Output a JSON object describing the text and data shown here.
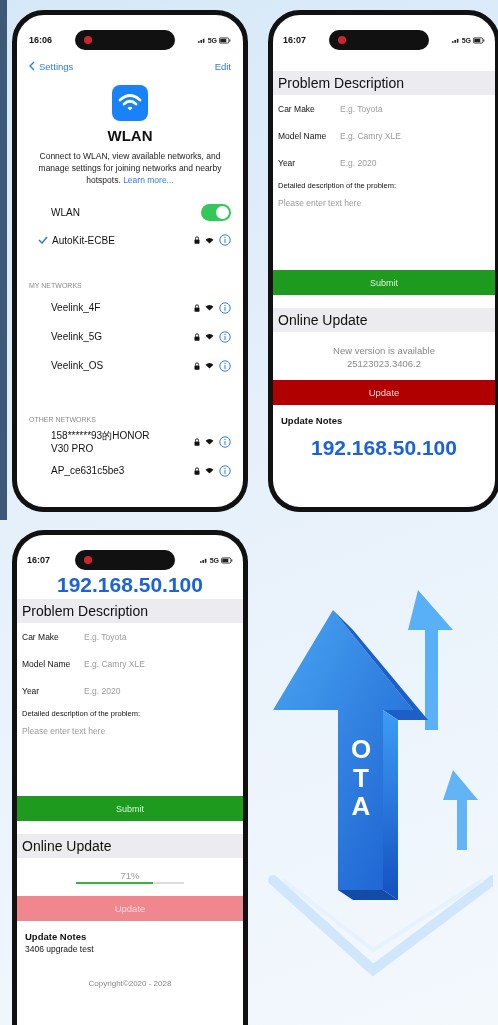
{
  "wlan_screen": {
    "status_bar": {
      "time": "16:06",
      "network": "5G"
    },
    "nav": {
      "back": "Settings",
      "action": "Edit"
    },
    "title": "WLAN",
    "description": "Connect to WLAN, view available networks, and manage settings for joining networks and nearby hotspots.",
    "learn_more": "Learn more...",
    "wlan_toggle": {
      "label": "WLAN",
      "on": true
    },
    "connected": {
      "name": "AutoKit-ECBE",
      "selected": true
    },
    "sections": [
      {
        "heading": "MY NETWORKS",
        "networks": [
          {
            "name": "Veelink_4F"
          },
          {
            "name": "Veelink_5G"
          },
          {
            "name": "Veelink_OS"
          }
        ]
      },
      {
        "heading": "OTHER NETWORKS",
        "networks": [
          {
            "name": "158******93的HONOR V30 PRO"
          },
          {
            "name": "AP_ce631c5be3"
          }
        ]
      }
    ]
  },
  "form_screens": [
    {
      "status_bar": {
        "time": "16:07",
        "network": "5G"
      },
      "footer_ip": "192.168.50.100",
      "problem": {
        "title": "Problem Description",
        "fields": [
          {
            "label": "Car Make",
            "placeholder": "E.g. Toyota"
          },
          {
            "label": "Model Name",
            "placeholder": "E.g. Camry XLE"
          },
          {
            "label": "Year",
            "placeholder": "E.g. 2020"
          }
        ],
        "detail_label": "Detailed description of the problem:",
        "detail_placeholder": "Please enter text here",
        "submit": "Submit"
      },
      "update": {
        "title": "Online Update",
        "kind": "available",
        "message": "New version is available",
        "version": "25123023.3406.2",
        "button": {
          "label": "Update",
          "disabled": false
        }
      },
      "notes": {
        "title": "Update Notes"
      }
    },
    {
      "status_bar": {
        "time": "16:07",
        "network": "5G"
      },
      "header_ip": "192.168.50.100",
      "problem": {
        "title": "Problem Description",
        "fields": [
          {
            "label": "Car Make",
            "placeholder": "E.g. Toyota"
          },
          {
            "label": "Model Name",
            "placeholder": "E.g. Camry XLE"
          },
          {
            "label": "Year",
            "placeholder": "E.g. 2020"
          }
        ],
        "detail_label": "Detailed description of the problem:",
        "detail_placeholder": "Please enter text here",
        "submit": "Submit"
      },
      "update": {
        "title": "Online Update",
        "kind": "progress",
        "percent": "71%",
        "level": 0.71,
        "button": {
          "label": "Update",
          "disabled": true
        }
      },
      "notes": {
        "title": "Update Notes",
        "text": "3406 upgrade test"
      },
      "copyright": "Copyright©2020 - 2028"
    }
  ],
  "illustration": {
    "label": "OTA"
  }
}
